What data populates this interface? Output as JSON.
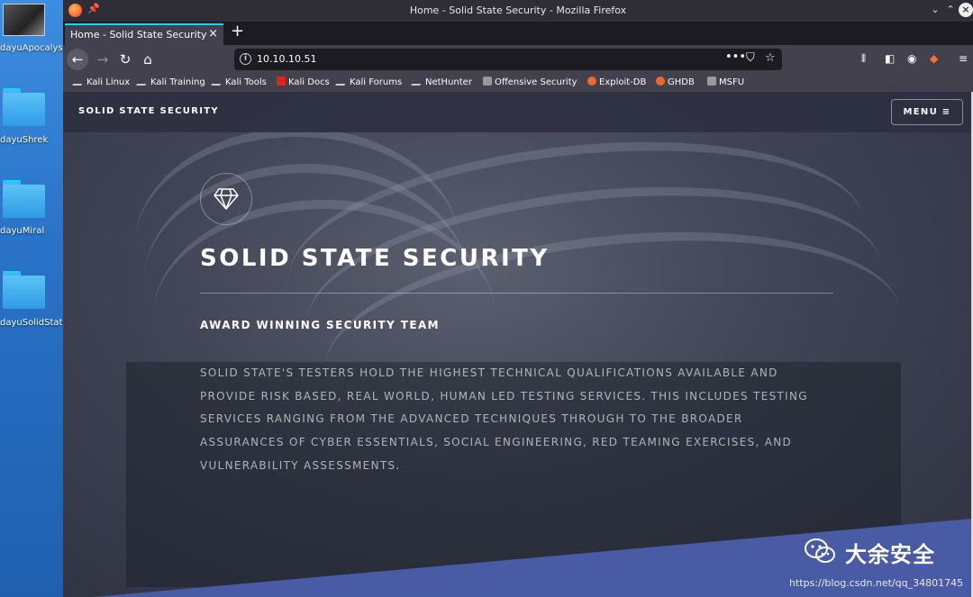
{
  "desktop": {
    "icons": [
      {
        "label": "dayuApocalyst"
      },
      {
        "label": "dayuShrek"
      },
      {
        "label": "dayuMiral"
      },
      {
        "label": "dayuSolidState"
      }
    ]
  },
  "window": {
    "title": "Home - Solid State Security - Mozilla Firefox"
  },
  "tab": {
    "title": "Home - Solid State Security",
    "close": "×",
    "new": "+"
  },
  "urlbar": {
    "url": "10.10.10.51",
    "info_glyph": "i",
    "more": "•••"
  },
  "bookmarks": [
    {
      "label": "Kali Linux",
      "icon": "kali-dragon-icon"
    },
    {
      "label": "Kali Training",
      "icon": "kali-dragon-icon"
    },
    {
      "label": "Kali Tools",
      "icon": "kali-dragon-icon"
    },
    {
      "label": "Kali Docs",
      "icon": "kali-docs-icon"
    },
    {
      "label": "Kali Forums",
      "icon": "kali-dragon-icon"
    },
    {
      "label": "NetHunter",
      "icon": "nethunter-icon"
    },
    {
      "label": "Offensive Security",
      "icon": "offsec-icon"
    },
    {
      "label": "Exploit-DB",
      "icon": "exploitdb-icon"
    },
    {
      "label": "GHDB",
      "icon": "ghdb-icon"
    },
    {
      "label": "MSFU",
      "icon": "msfu-icon"
    }
  ],
  "site": {
    "brand": "SOLID STATE SECURITY",
    "menu": "MENU ≡",
    "hero_title": "SOLID STATE SECURITY",
    "hero_subtitle": "AWARD WINNING SECURITY TEAM",
    "hero_body": "Solid State's testers hold the highest technical qualifications available and provide risk based, real world, human led testing services. This includes testing services ranging from the advanced techniques through to the broader assurances of Cyber Essentials, Social Engineering, Red Teaming exercises, and Vulnerability Assessments."
  },
  "watermark": {
    "text": "大余安全",
    "url": "https://blog.csdn.net/qq_34801745"
  },
  "colors": {
    "accent_tab": "#00ddff",
    "hero_band": "#4a5ba5",
    "desktop": "#2a73c8"
  }
}
